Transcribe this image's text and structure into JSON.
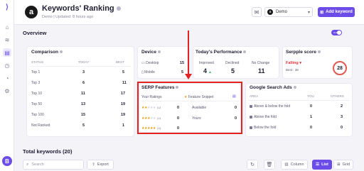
{
  "app": {
    "title": "Keywords' Ranking",
    "subtitle": "Demo | Updated: 8 hours ago",
    "brand_icon": "a",
    "project_select": "Demo",
    "add_keyword": "Add keyword",
    "avatar_initial": "B"
  },
  "overview": {
    "title": "Overview",
    "toggle_label": "Hide"
  },
  "comparison": {
    "title": "Comparison",
    "headers": [
      "STATUS",
      "TODAY",
      "BEST"
    ],
    "rows": [
      {
        "label": "Top 1",
        "today": "3",
        "best": "5"
      },
      {
        "label": "Top 3",
        "today": "6",
        "best": "11"
      },
      {
        "label": "Top 10",
        "today": "11",
        "best": "17"
      },
      {
        "label": "Top 50",
        "today": "13",
        "best": "19"
      },
      {
        "label": "Top 100",
        "today": "15",
        "best": "19"
      },
      {
        "label": "Not Ranked",
        "today": "5",
        "best": "1"
      }
    ]
  },
  "device": {
    "title": "Device",
    "rows": [
      {
        "label": "Desktop",
        "value": "15"
      },
      {
        "label": "Mobile",
        "value": "5"
      }
    ]
  },
  "todays_performance": {
    "title": "Today's Performance",
    "cols": [
      {
        "label": "Improved",
        "value": "4",
        "arrow": "▲"
      },
      {
        "label": "Declined",
        "value": "5",
        "arrow": ""
      },
      {
        "label": "No Change",
        "value": "11",
        "arrow": ""
      }
    ]
  },
  "serpple_score": {
    "title": "Serpple score",
    "status": "Falling ▾",
    "best": "Best : 38",
    "score": "28"
  },
  "serp_features": {
    "title": "SERP Features",
    "your_ratings": "Your Ratings",
    "feature_label": "Feature Snippet",
    "rows": [
      {
        "stars": 2,
        "range": "(0-2)",
        "count": "0",
        "label": "Available",
        "value": "0"
      },
      {
        "stars": 3,
        "range": "(2-4)",
        "count": "0",
        "label": "Yours",
        "value": "0"
      },
      {
        "stars": 5,
        "range": "(4-5)",
        "count": "0",
        "label": "",
        "value": ""
      }
    ]
  },
  "google_ads": {
    "title": "Google Search Ads",
    "headers": [
      "AREA",
      "YOU",
      "OTHERS"
    ],
    "rows": [
      {
        "label": "Above & below the fold",
        "you": "0",
        "others": "2"
      },
      {
        "label": "Above the fold",
        "you": "1",
        "others": "3"
      },
      {
        "label": "Below the fold",
        "you": "0",
        "others": "0"
      }
    ]
  },
  "keywords": {
    "total_label": "Total keywords (20)",
    "search_placeholder": "Search",
    "export": "Export",
    "columns": "Column",
    "list": "List",
    "grid": "Grid"
  }
}
